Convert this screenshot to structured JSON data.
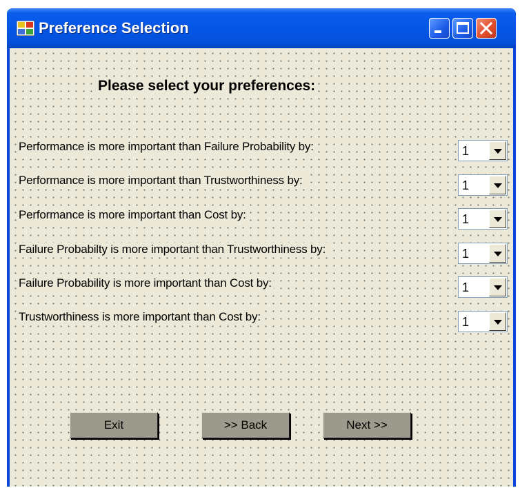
{
  "window": {
    "title": "Preference Selection"
  },
  "heading": "Please select your preferences:",
  "preferences": [
    {
      "label": "Performance is more  important than Failure Probability by:",
      "value": "1"
    },
    {
      "label": "Performance is more  important than Trustworthiness by:",
      "value": "1"
    },
    {
      "label": "Performance is more important than Cost by:",
      "value": "1"
    },
    {
      "label": "Failure Probabilty is more important than Trustworthiness by:",
      "value": "1"
    },
    {
      "label": "Failure Probability is more important than Cost by:",
      "value": "1"
    },
    {
      "label": "Trustworthiness is more important than Cost by:",
      "value": "1"
    }
  ],
  "buttons": {
    "exit": "Exit",
    "back": ">> Back",
    "next": "Next >>"
  },
  "icons": {
    "app": "app-window-icon",
    "minimize": "minimize-icon",
    "maximize": "maximize-icon",
    "close": "close-icon",
    "dropdown": "chevron-down-icon"
  },
  "colors": {
    "titlebar": "#0a5ded",
    "client_bg": "#ece9d8",
    "close_button": "#e1502d",
    "button_face": "#9b9a8c"
  }
}
